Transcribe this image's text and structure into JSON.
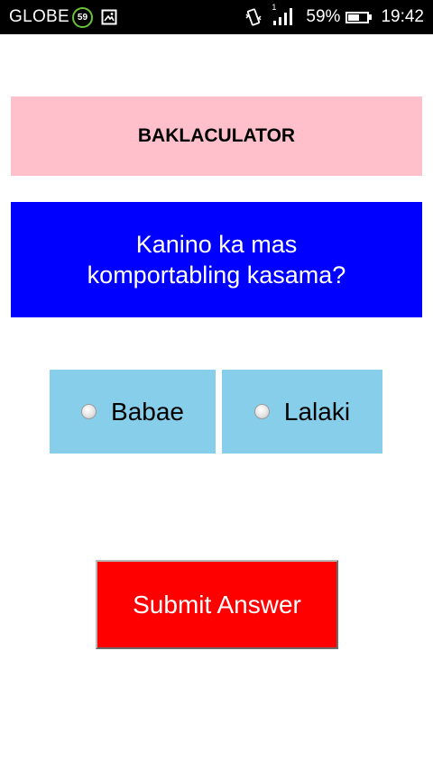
{
  "status_bar": {
    "carrier": "GLOBE",
    "badge": "59",
    "sim_number": "1",
    "battery_percent": "59%",
    "battery_level": 0.59,
    "time": "19:42",
    "icons": [
      "image-icon",
      "vibrate-icon",
      "signal-icon",
      "battery-icon"
    ]
  },
  "app": {
    "title": "BAKLACULATOR",
    "question_line1": "Kanino ka mas",
    "question_line2": "komportabling kasama?",
    "options": [
      {
        "label": "Babae",
        "selected": false
      },
      {
        "label": "Lalaki",
        "selected": false
      }
    ],
    "submit_label": "Submit Answer"
  },
  "colors": {
    "title_bg": "#ffc0cb",
    "question_bg": "#0000ff",
    "option_bg": "#87ceeb",
    "submit_bg": "#ff0000",
    "status_bg": "#000000"
  }
}
